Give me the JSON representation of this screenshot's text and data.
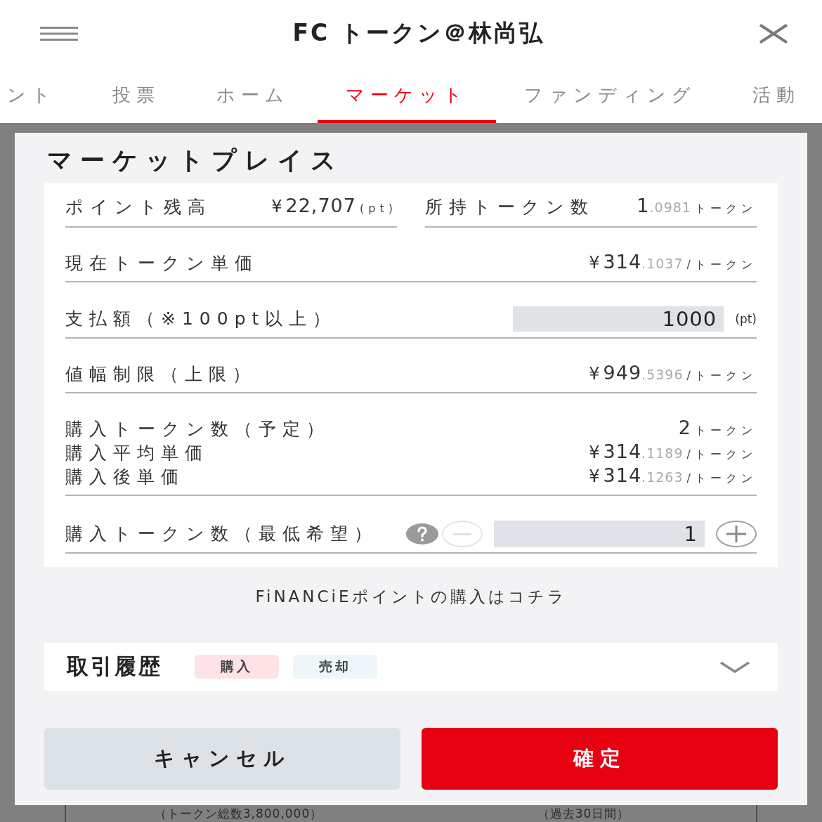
{
  "header": {
    "title": "FC トークン＠林尚弘"
  },
  "tabs": [
    {
      "label": "ント",
      "selected": false
    },
    {
      "label": "投票",
      "selected": false
    },
    {
      "label": "ホーム",
      "selected": false
    },
    {
      "label": "マーケット",
      "selected": true
    },
    {
      "label": "ファンディング",
      "selected": false
    },
    {
      "label": "活動",
      "selected": false
    }
  ],
  "modal": {
    "title": "マーケットプレイス",
    "rows": [
      {
        "kind": "pair",
        "items": [
          {
            "label": "ポイント残高",
            "value": {
              "currency": "¥",
              "integer": "22,707",
              "unit": "(pt)"
            }
          },
          {
            "label": "所持トークン数",
            "value": {
              "integer": "1",
              "decimal": ".0981",
              "unit": "トークン"
            }
          }
        ]
      },
      {
        "kind": "value",
        "lines": [
          {
            "label": "現在トークン単価",
            "value": {
              "currency": "¥",
              "integer": "314",
              "decimal": ".1037",
              "unit": "/トークン"
            }
          }
        ]
      },
      {
        "kind": "input",
        "label": "支払額（※100pt以上）",
        "value": "1000",
        "unit": "(pt)"
      },
      {
        "kind": "value",
        "lines": [
          {
            "label": "値幅制限（上限）",
            "value": {
              "currency": "¥",
              "integer": "949",
              "decimal": ".5396",
              "unit": "/トークン"
            }
          }
        ]
      },
      {
        "kind": "value",
        "lines": [
          {
            "label": "購入トークン数（予定）",
            "value": {
              "integer": "2",
              "unit": "トークン"
            }
          },
          {
            "label": "購入平均単価",
            "value": {
              "currency": "¥",
              "integer": "314",
              "decimal": ".1189",
              "unit": "/トークン"
            }
          },
          {
            "label": "購入後単価",
            "value": {
              "currency": "¥",
              "integer": "314",
              "decimal": ".1263",
              "unit": "/トークン"
            }
          }
        ]
      },
      {
        "kind": "stepper",
        "label": "購入トークン数（最低希望）",
        "value": "1",
        "minus": {
          "disabled": true
        },
        "plus": {
          "disabled": false
        }
      }
    ],
    "link": "FiNANCiEポイントの購入はコチラ",
    "history": {
      "title": "取引履歴",
      "expanded": false,
      "tags": [
        {
          "label": "購入",
          "color": "#fde3e6"
        },
        {
          "label": "売却",
          "color": "#eef6fa"
        }
      ]
    },
    "buttons": [
      {
        "kind": "cancel",
        "label": "キャンセル"
      },
      {
        "kind": "confirm",
        "label": "確定"
      }
    ]
  },
  "background": {
    "texts": [
      "（トークン総数3,800,000）",
      "（過去30日間）"
    ]
  }
}
